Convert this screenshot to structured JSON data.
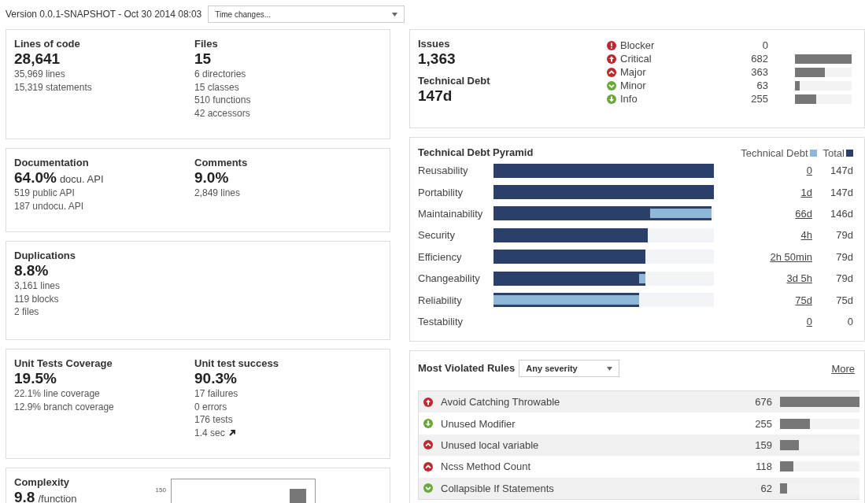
{
  "header": {
    "version": "Version 0.0.1-SNAPSHOT - Oct 30 2014 08:03",
    "time_select": {
      "value": "Time changes..."
    }
  },
  "left_cards": [
    {
      "kind": "two",
      "columns": [
        {
          "title": "Lines of code",
          "value": "28,641",
          "details": [
            "35,969 lines",
            "15,319 statements"
          ]
        },
        {
          "title": "Files",
          "value": "15",
          "details": [
            "6 directories",
            "15 classes",
            "510 functions",
            "42 accessors"
          ]
        }
      ]
    },
    {
      "kind": "two",
      "columns": [
        {
          "title": "Documentation",
          "value": "64.0%",
          "suffix": "docu. API",
          "details": [
            "519 public API",
            "187 undocu. API"
          ]
        },
        {
          "title": "Comments",
          "value": "9.0%",
          "details": [
            "2,849 lines"
          ]
        }
      ]
    },
    {
      "kind": "one",
      "columns": [
        {
          "title": "Duplications",
          "value": "8.8%",
          "details": [
            "3,161 lines",
            "119 blocks",
            "2 files"
          ]
        }
      ]
    },
    {
      "kind": "two",
      "columns": [
        {
          "title": "Unit Tests Coverage",
          "value": "19.5%",
          "details": [
            "22.1% line coverage",
            "12.9% branch coverage"
          ]
        },
        {
          "title": "Unit test success",
          "value": "90.3%",
          "details": [
            "17 failures",
            "0 errors",
            "176 tests",
            "1.4 sec"
          ],
          "link_arrow": true
        }
      ]
    },
    {
      "kind": "chart",
      "columns": [
        {
          "title": "Complexity",
          "value": "9.8",
          "suffix": "/function"
        }
      ],
      "chart_tick": "150"
    }
  ],
  "issues": {
    "title": "Issues",
    "value": "1,363",
    "debt_title": "Technical Debt",
    "debt_value": "147d",
    "severities": [
      {
        "kind": "blocker",
        "label": "Blocker",
        "count": "0"
      },
      {
        "kind": "critical",
        "label": "Critical",
        "count": "682",
        "bar": {
          "level": 1
        }
      },
      {
        "kind": "major",
        "label": "Major",
        "count": "363",
        "bar": {
          "level": 0.53
        }
      },
      {
        "kind": "minor",
        "label": "Minor",
        "count": "63",
        "bar": {
          "level": 0.09
        }
      },
      {
        "kind": "info",
        "label": "Info",
        "count": "255",
        "bar": {
          "level": 0.37
        }
      }
    ]
  },
  "pyramid": {
    "title": "Technical Debt Pyramid",
    "legend_debt": "Technical Debt",
    "legend_total": "Total",
    "rows": [
      {
        "label": "Reusability",
        "total_bar": {
          "level": 1
        },
        "debt": "0",
        "total": "147d"
      },
      {
        "label": "Portability",
        "total_bar": {
          "level": 1
        },
        "debt": "1d",
        "total": "147d"
      },
      {
        "label": "Maintainability",
        "total_bar": {
          "level": 0.99
        },
        "debt_bar": {
          "level": 0.28
        },
        "debt": "66d",
        "total": "146d"
      },
      {
        "label": "Security",
        "total_bar": {
          "level": 0.7
        },
        "debt": "4h",
        "total": "79d"
      },
      {
        "label": "Efficiency",
        "total_bar": {
          "level": 0.69
        },
        "debt": "2h 50min",
        "total": "79d"
      },
      {
        "label": "Changeability",
        "total_bar": {
          "level": 0.69
        },
        "debt_bar": {
          "level": 0.03
        },
        "debt": "3d 5h",
        "total": "79d"
      },
      {
        "label": "Reliability",
        "total_bar": {
          "level": 0.66
        },
        "debt_bar": {
          "level": 0.66
        },
        "debt": "75d",
        "total": "75d"
      },
      {
        "label": "Testability",
        "debt": "0",
        "total": "0"
      }
    ]
  },
  "rules": {
    "title": "Most Violated Rules",
    "severity_select": {
      "value": "Any severity"
    },
    "more": "More",
    "rows": [
      {
        "kind": "critical",
        "name": "Avoid Catching Throwable",
        "count": "676",
        "bar": {
          "level": 1
        }
      },
      {
        "kind": "info",
        "name": "Unused Modifier",
        "count": "255",
        "bar": {
          "level": 0.38
        }
      },
      {
        "kind": "major",
        "name": "Unused local variable",
        "count": "159",
        "bar": {
          "level": 0.24
        }
      },
      {
        "kind": "major",
        "name": "Ncss Method Count",
        "count": "118",
        "bar": {
          "level": 0.17
        }
      },
      {
        "kind": "minor",
        "name": "Collapsible If Statements",
        "count": "62",
        "bar": {
          "level": 0.09
        }
      }
    ]
  }
}
